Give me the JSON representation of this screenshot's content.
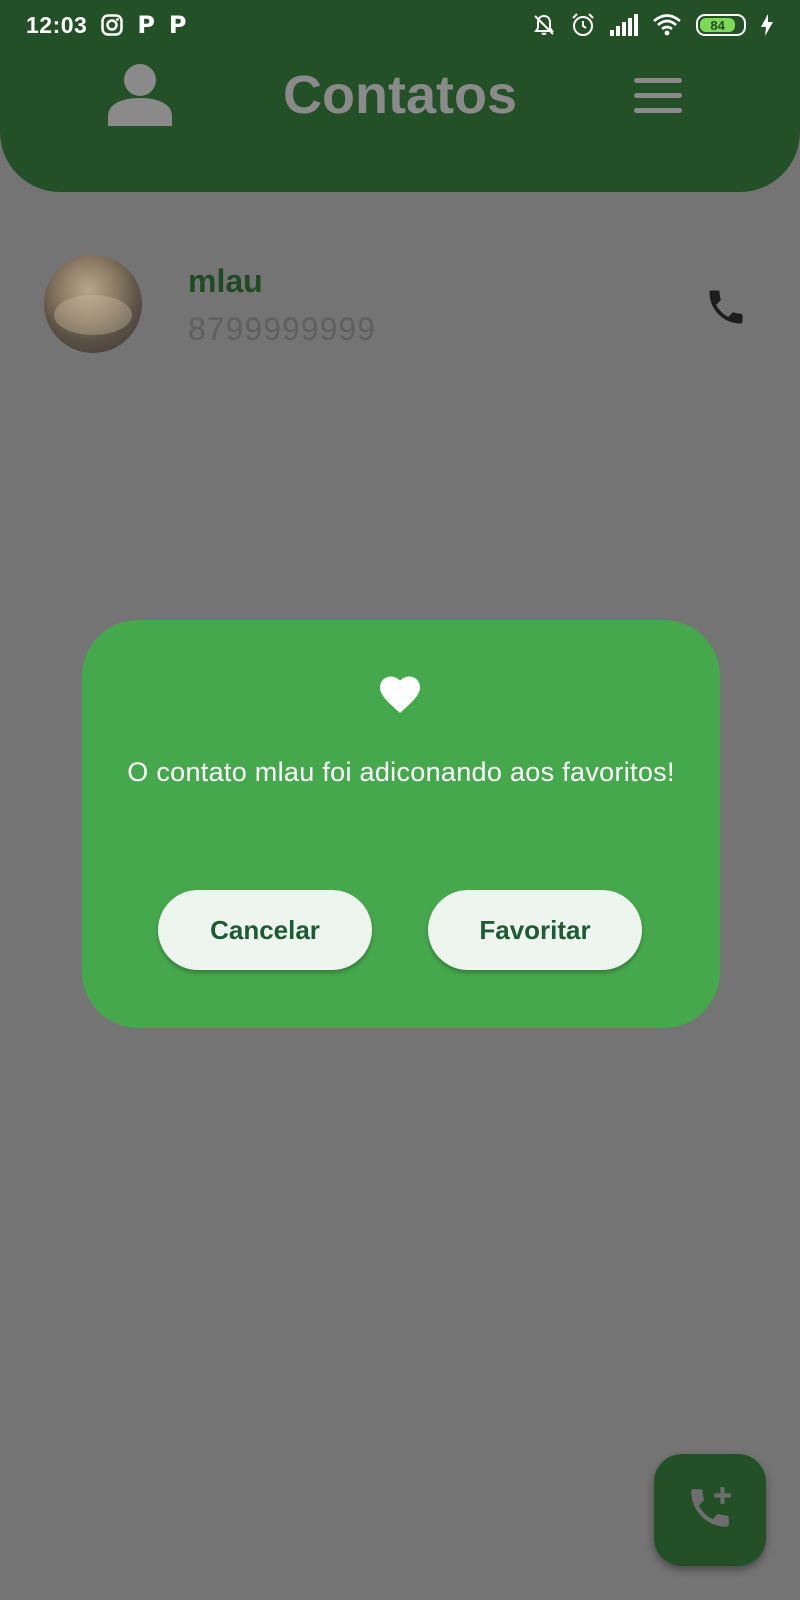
{
  "status_bar": {
    "time": "12:03",
    "notif_p1": "P",
    "notif_p2": "P",
    "battery_level": "84",
    "icons": [
      "instagram-icon",
      "p-app-icon",
      "p-app-icon",
      "bell-off-icon",
      "alarm-icon",
      "signal-icon",
      "wifi-icon",
      "battery-icon",
      "charging-icon"
    ]
  },
  "header": {
    "title": "Contatos",
    "left_icon": "person-icon",
    "right_icon": "menu-icon",
    "background": "#235027"
  },
  "contacts": [
    {
      "name": "mlau",
      "phone": "8799999999",
      "action_icon": "phone-icon"
    }
  ],
  "dialog": {
    "icon": "heart-icon",
    "message": "O contato mlau foi adiconando aos favoritos!",
    "cancel_label": "Cancelar",
    "confirm_label": "Favoritar",
    "background": "#46a84d"
  },
  "fab": {
    "icon": "add-call-icon",
    "background": "#235027"
  }
}
